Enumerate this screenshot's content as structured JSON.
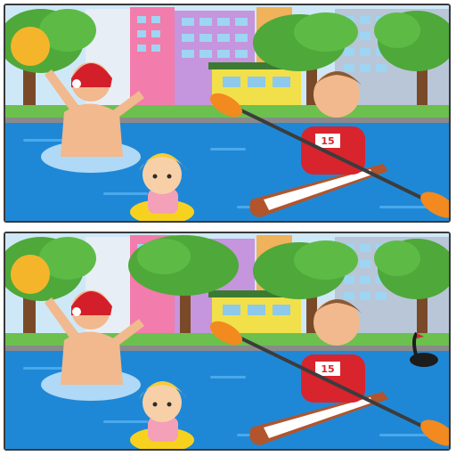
{
  "puzzle": {
    "panels": [
      {
        "id": "top",
        "bib": "15",
        "show_swan": false,
        "show_extra_tree": false
      },
      {
        "id": "bottom",
        "bib": "15",
        "show_swan": true,
        "show_extra_tree": true
      }
    ]
  },
  "colors": {
    "water": "#1f88d6",
    "water_light": "#4aa9ec",
    "kayak": "#b2542c",
    "paddle": "#f28a1f",
    "shirt": "#d8242d",
    "cap": "#d31f2a",
    "ball": "#f5b52a",
    "float_ring": "#f6d21f",
    "swimsuit": "#f3a0b8"
  }
}
